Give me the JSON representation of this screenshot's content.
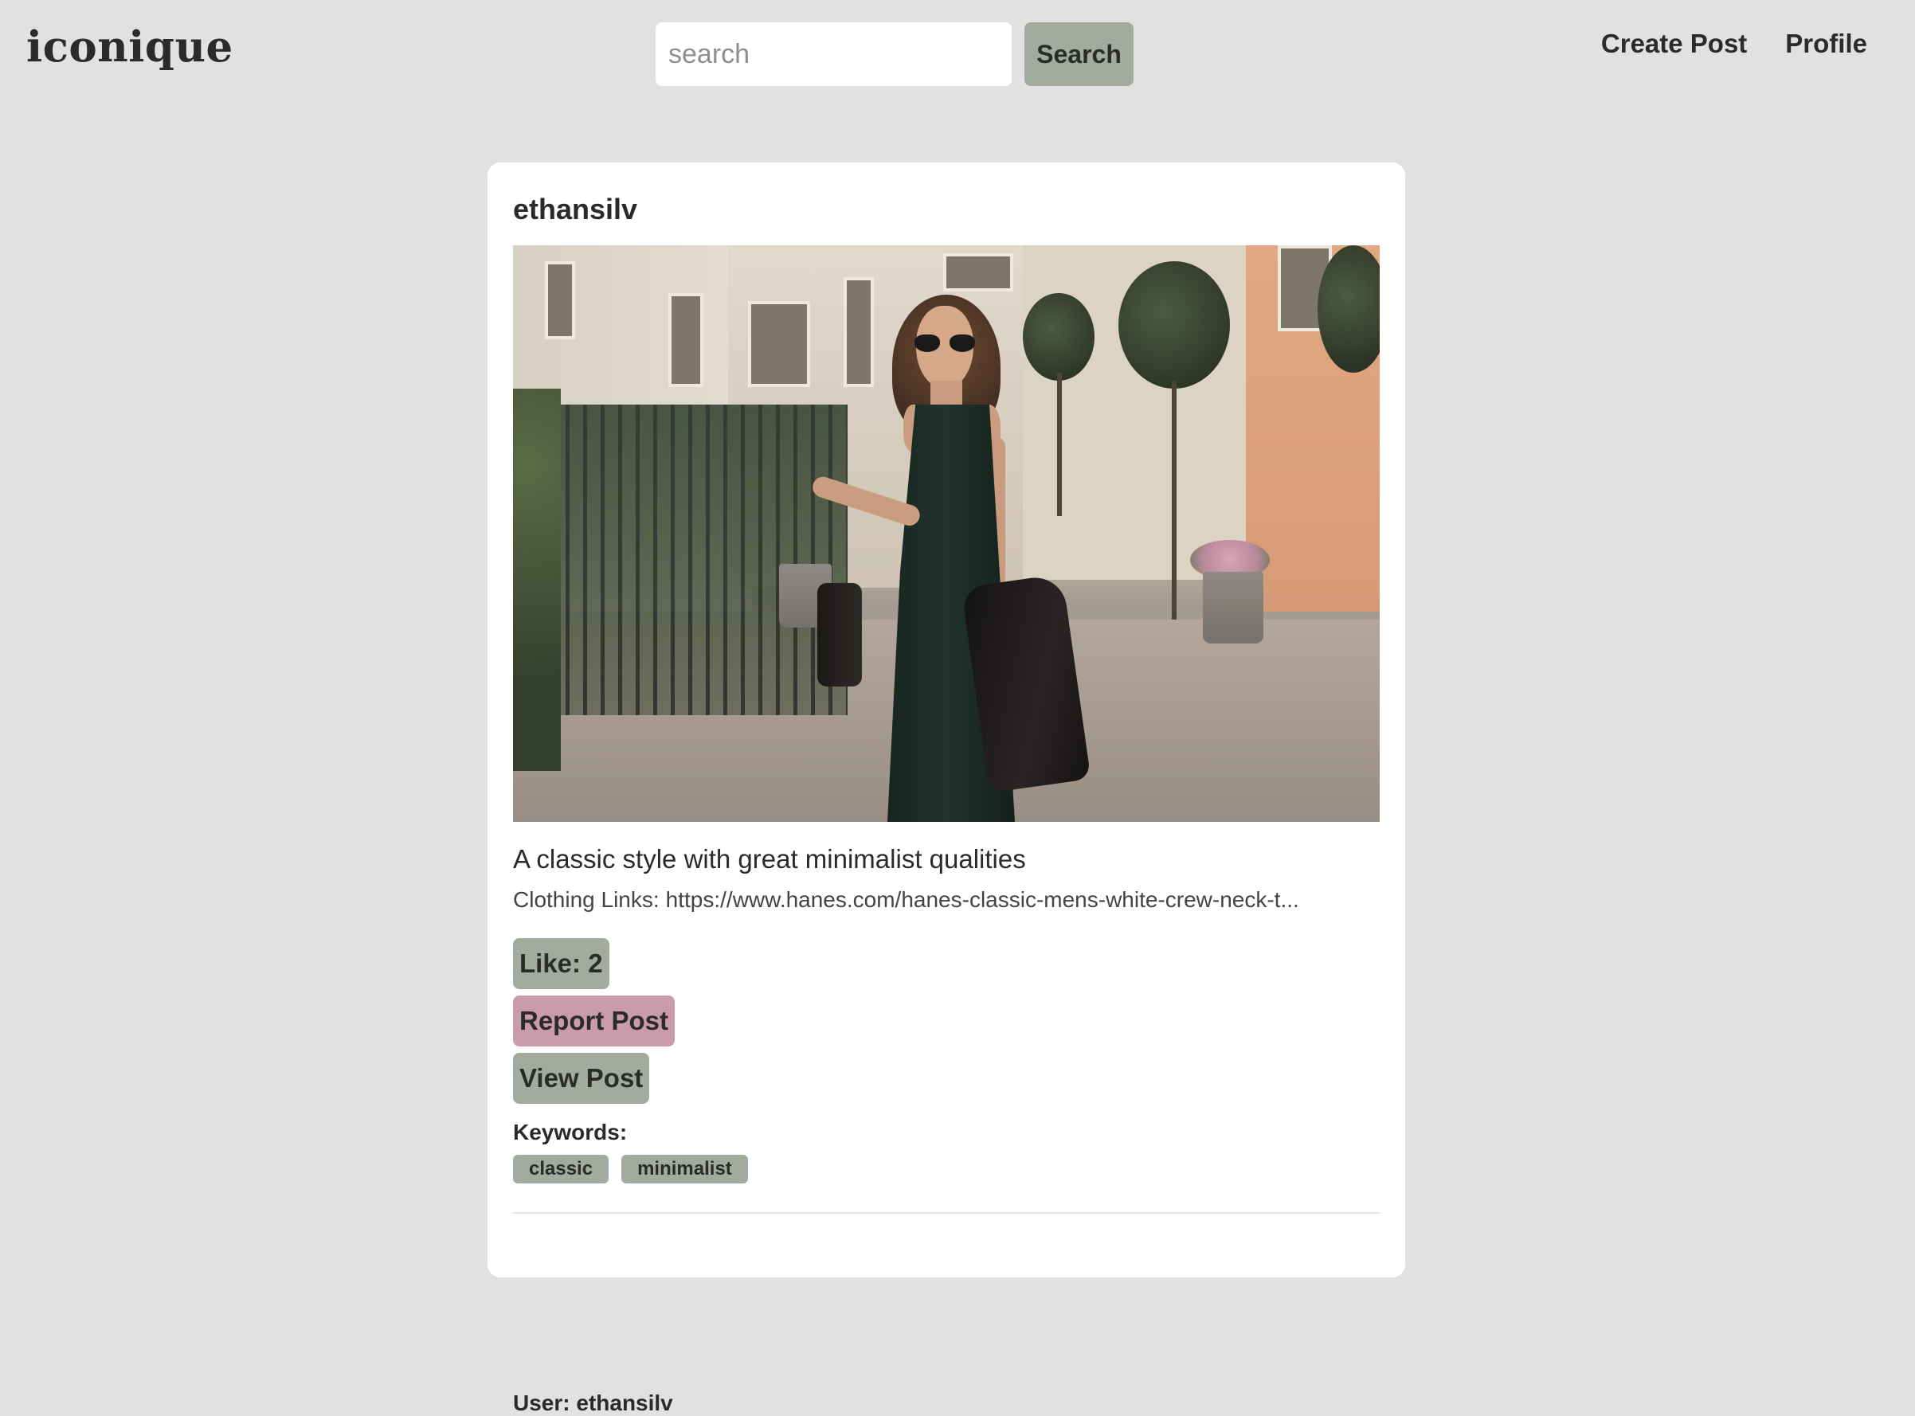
{
  "app": {
    "logo": "iconique"
  },
  "search": {
    "placeholder": "search",
    "value": "",
    "button_label": "Search"
  },
  "nav": {
    "items": [
      {
        "label": "Create Post"
      },
      {
        "label": "Profile"
      }
    ]
  },
  "post": {
    "username": "ethansilv",
    "image_alt": "Woman in a dark green satin slip dress and sunglasses walking on a city street",
    "caption": "A classic style with great minimalist qualities",
    "links_label": "Clothing Links:",
    "links_value": "https://www.hanes.com/hanes-classic-mens-white-crew-neck-t...",
    "like_label": "Like: 2",
    "report_label": "Report Post",
    "view_label": "View Post",
    "keywords_label": "Keywords:",
    "keywords": [
      "classic",
      "minimalist"
    ],
    "meta_user": "User: ethansilv"
  },
  "colors": {
    "page_background": "#e2e1df",
    "card_background": "#ffffff",
    "sage_button": "#a3aa9e",
    "pink_button": "#c99bad",
    "text_primary": "#2b2b2b"
  }
}
